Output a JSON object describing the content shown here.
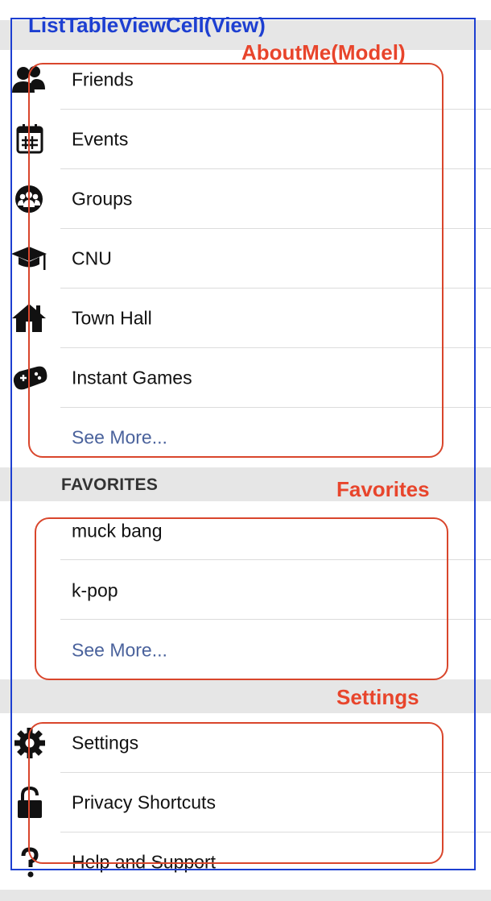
{
  "annotations": {
    "view_label": "ListTableViewCell(View)",
    "aboutme_label": "AboutMe(Model)",
    "favorites_label": "Favorites",
    "settings_label": "Settings"
  },
  "colors": {
    "annotation_red": "#d9462c",
    "annotation_blue": "#1d3fd1",
    "link_blue": "#4a629c",
    "section_gray": "#e6e6e6"
  },
  "menu": {
    "items": [
      {
        "label": "Friends",
        "icon": "friends-icon"
      },
      {
        "label": "Events",
        "icon": "calendar-icon"
      },
      {
        "label": "Groups",
        "icon": "groups-icon"
      },
      {
        "label": "CNU",
        "icon": "graduation-cap-icon"
      },
      {
        "label": "Town Hall",
        "icon": "town-hall-icon"
      },
      {
        "label": "Instant Games",
        "icon": "gamepad-icon"
      }
    ],
    "see_more": "See More..."
  },
  "favorites": {
    "header": "FAVORITES",
    "items": [
      "muck bang",
      "k-pop"
    ],
    "see_more": "See More..."
  },
  "settings": {
    "items": [
      {
        "label": "Settings",
        "icon": "gear-icon"
      },
      {
        "label": "Privacy Shortcuts",
        "icon": "lock-icon"
      },
      {
        "label": "Help and Support",
        "icon": "question-icon"
      }
    ]
  }
}
